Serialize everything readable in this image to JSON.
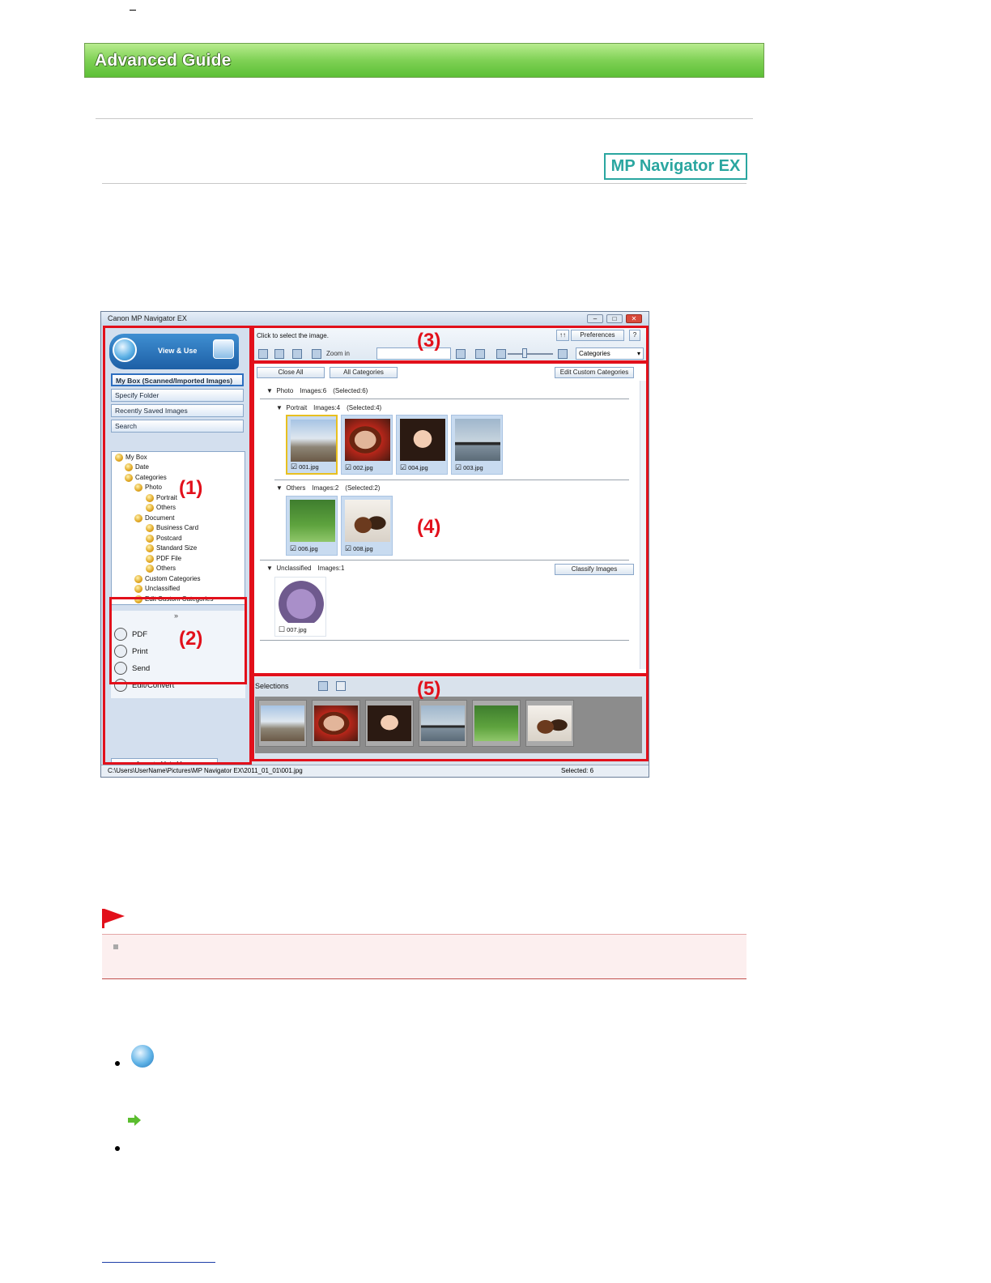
{
  "banner": {
    "title": "Advanced Guide"
  },
  "product_badge": "MP Navigator EX",
  "window": {
    "title": "Canon MP Navigator EX",
    "controls": {
      "minimize": "–",
      "maximize": "□",
      "close": "✕"
    },
    "left_panel": {
      "header_label": "View & Use",
      "nav_buttons": [
        {
          "label": "My Box (Scanned/Imported Images)",
          "active": true
        },
        {
          "label": "Specify Folder",
          "active": false
        },
        {
          "label": "Recently Saved Images",
          "active": false
        },
        {
          "label": "Search",
          "active": false
        }
      ],
      "tree": [
        "My Box",
        "Date",
        "Categories",
        "Photo",
        "Portrait",
        "Others",
        "Document",
        "Business Card",
        "Postcard",
        "Standard Size",
        "PDF File",
        "Others",
        "Custom Categories",
        "Unclassified",
        "Edit Custom Categories"
      ],
      "chevron": "»",
      "actions": [
        "PDF",
        "Print",
        "Send",
        "Edit/Convert"
      ],
      "jump_button": "Jump to Main Menu"
    },
    "toolbar": {
      "hint": "Click to select the image.",
      "preferences_label": "Preferences",
      "preferences_icon": "↑↑",
      "help_label": "?",
      "zoom_label": "Zoom in",
      "category_select": "Categories"
    },
    "viewer": {
      "close_all": "Close All",
      "all_categories": "All Categories",
      "edit_custom_categories": "Edit Custom Categories",
      "classify_images": "Classify Images",
      "groups": {
        "photo": {
          "name": "Photo",
          "count": "Images:6",
          "selected": "(Selected:6)"
        },
        "portrait": {
          "name": "Portrait",
          "count": "Images:4",
          "selected": "(Selected:4)"
        },
        "others": {
          "name": "Others",
          "count": "Images:2",
          "selected": "(Selected:2)"
        },
        "unclassified": {
          "name": "Unclassified",
          "count": "Images:1"
        }
      },
      "portrait_images": [
        "001.jpg",
        "002.jpg",
        "004.jpg",
        "003.jpg"
      ],
      "others_images": [
        "006.jpg",
        "008.jpg"
      ],
      "unclassified_images": [
        "007.jpg"
      ]
    },
    "selections": {
      "title": "Selections"
    },
    "status": {
      "path": "C:\\Users\\UserName\\Pictures\\MP Navigator EX\\2011_01_01\\001.jpg",
      "selected": "Selected: 6"
    },
    "callouts": [
      "(1)",
      "(2)",
      "(3)",
      "(4)",
      "(5)"
    ]
  }
}
